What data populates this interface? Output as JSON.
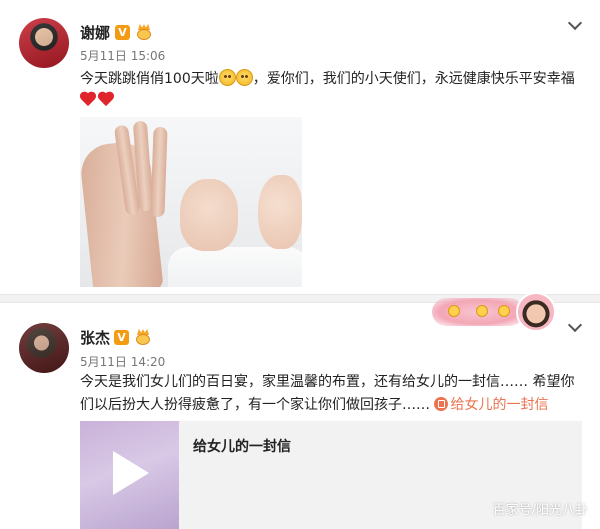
{
  "posts": [
    {
      "name": "谢娜",
      "verified_badge": "V",
      "time": "5月11日 15:06",
      "text_before_emoji": "今天跳跳俏俏100天啦",
      "text_after_emoji": "，爱你们，我们的小天使们，永远健康快乐平安幸福",
      "emojis": [
        "smile-emoji-icon",
        "smile-emoji-icon"
      ],
      "hearts": [
        "heart-icon",
        "heart-icon"
      ],
      "image": "baby-hands-photo"
    },
    {
      "name": "张杰",
      "verified_badge": "V",
      "time": "5月11日 14:20",
      "text": "今天是我们女儿们的百日宴，家里温馨的布置，还有给女儿的一封信…… 希望你们以后扮大人扮得疲惫了，有一个家让你们做回孩子……",
      "link_text": "给女儿的一封信",
      "card": {
        "title": "给女儿的一封信",
        "thumb_icon": "play-icon"
      }
    }
  ],
  "watermark": "百家号/阳光八卦",
  "colors": {
    "link": "#eb7350",
    "verified": "#f49b14",
    "heart": "#e0242c",
    "divider": "#f2f2f2"
  }
}
